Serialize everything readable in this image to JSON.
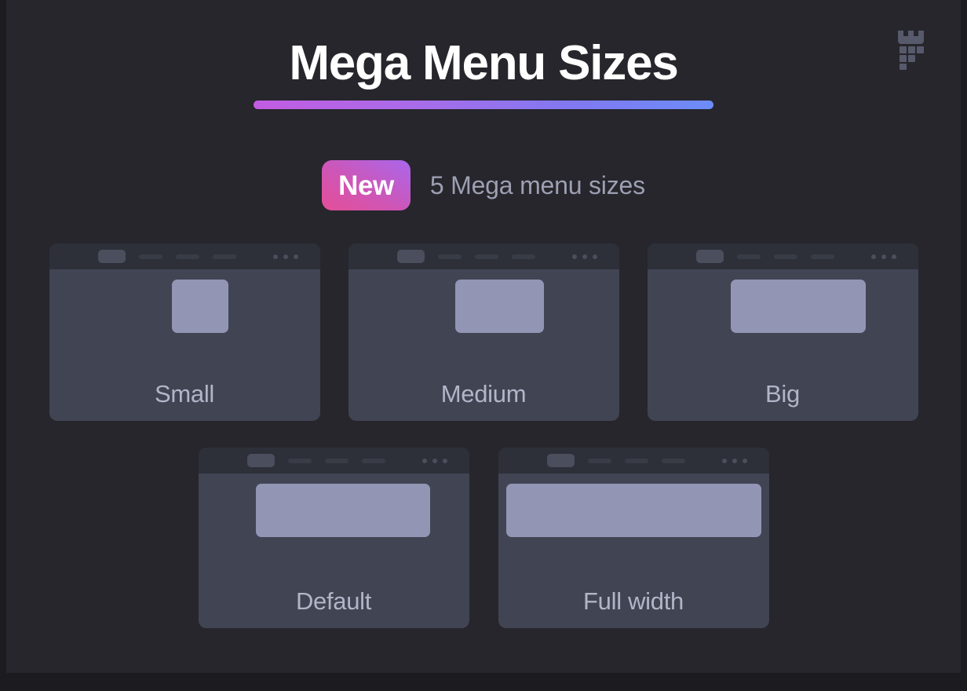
{
  "page": {
    "background_color": "#26262c",
    "outer_border_color": "#1b1b20"
  },
  "header": {
    "title": "Mega Menu Sizes",
    "title_color": "#ffffff",
    "rule_gradient_from": "#c25ce2",
    "rule_gradient_to": "#6c8df7"
  },
  "logo": {
    "name": "castle-tower-logo-icon",
    "color": "#565a6b"
  },
  "subtitle": {
    "badge_label": "New",
    "badge_gradient_from": "#e44f97",
    "badge_gradient_to": "#a967ec",
    "text": "5 Mega menu sizes",
    "text_color": "#9d9fb2"
  },
  "cards": {
    "header_pill_color": "#4a4e5d",
    "header_dash_color": "#383c47",
    "card_bg_color": "#414453",
    "card_header_bg_color": "#2d3039",
    "panel_color": "#9296b4",
    "label_color": "#b2b5c7",
    "nav_dash_count": 3,
    "dot_count": 3,
    "items": [
      {
        "id": "small",
        "label": "Small"
      },
      {
        "id": "medium",
        "label": "Medium"
      },
      {
        "id": "big",
        "label": "Big"
      },
      {
        "id": "default",
        "label": "Default"
      },
      {
        "id": "fullwidth",
        "label": "Full width"
      }
    ]
  }
}
